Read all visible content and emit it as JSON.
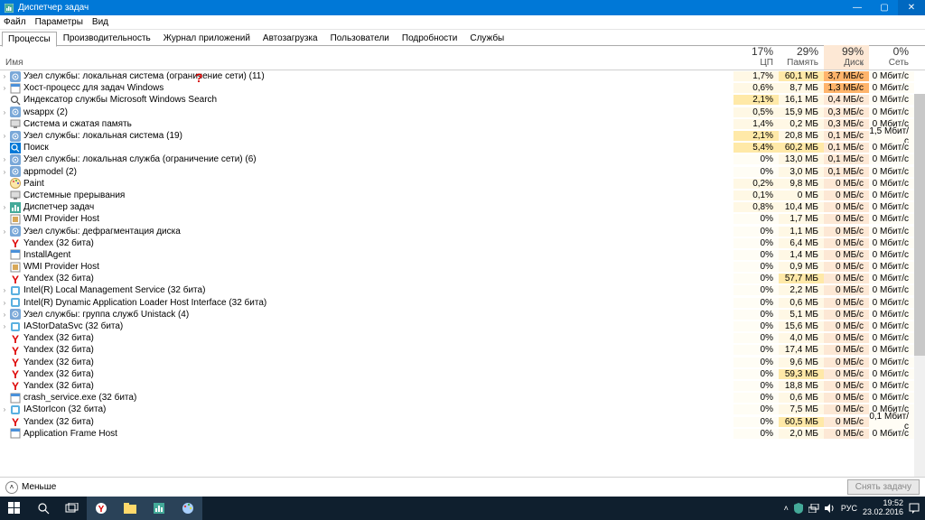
{
  "window": {
    "title": "Диспетчер задач",
    "controls": {
      "min": "—",
      "max": "▢",
      "close": "✕"
    }
  },
  "menu": [
    "Файл",
    "Параметры",
    "Вид"
  ],
  "tabs": [
    "Процессы",
    "Производительность",
    "Журнал приложений",
    "Автозагрузка",
    "Пользователи",
    "Подробности",
    "Службы"
  ],
  "columns": {
    "name": "Имя",
    "cpu": {
      "pct": "17%",
      "label": "ЦП"
    },
    "mem": {
      "pct": "29%",
      "label": "Память"
    },
    "disk": {
      "pct": "99%",
      "label": "Диск",
      "sorted": true,
      "arrow": "▾"
    },
    "net": {
      "pct": "0%",
      "label": "Сеть"
    }
  },
  "annotation": {
    "qmark": "?"
  },
  "processes": [
    {
      "exp": true,
      "icon": "svc",
      "name": "Узел службы: локальная система (ограничение сети) (11)",
      "cpu": "1,7%",
      "mem": "60,1 МБ",
      "disk": "3,7 МБ/с",
      "net": "0 Мбит/с",
      "underlined": true,
      "diskhot": true
    },
    {
      "exp": true,
      "icon": "exe",
      "name": "Хост-процесс для задач Windows",
      "cpu": "0,6%",
      "mem": "8,7 МБ",
      "disk": "1,3 МБ/с",
      "net": "0 Мбит/с",
      "underlined": true,
      "diskhot": true
    },
    {
      "exp": false,
      "icon": "search",
      "name": "Индексатор службы Microsoft Windows Search",
      "cpu": "2,1%",
      "mem": "16,1 МБ",
      "disk": "0,4 МБ/с",
      "net": "0 Мбит/с"
    },
    {
      "exp": true,
      "icon": "svc",
      "name": "wsappx (2)",
      "cpu": "0,5%",
      "mem": "15,9 МБ",
      "disk": "0,3 МБ/с",
      "net": "0 Мбит/с"
    },
    {
      "exp": false,
      "icon": "sys",
      "name": "Система и сжатая память",
      "cpu": "1,4%",
      "mem": "0,2 МБ",
      "disk": "0,3 МБ/с",
      "net": "0 Мбит/с"
    },
    {
      "exp": true,
      "icon": "svc",
      "name": "Узел службы: локальная система (19)",
      "cpu": "2,1%",
      "mem": "20,8 МБ",
      "disk": "0,1 МБ/с",
      "net": "1,5 Мбит/с"
    },
    {
      "exp": false,
      "icon": "searchblue",
      "name": "Поиск",
      "cpu": "5,4%",
      "mem": "60,2 МБ",
      "disk": "0,1 МБ/с",
      "net": "0 Мбит/с"
    },
    {
      "exp": true,
      "icon": "svc",
      "name": "Узел службы: локальная служба (ограничение сети) (6)",
      "cpu": "0%",
      "mem": "13,0 МБ",
      "disk": "0,1 МБ/с",
      "net": "0 Мбит/с"
    },
    {
      "exp": true,
      "icon": "svc",
      "name": "appmodel (2)",
      "cpu": "0%",
      "mem": "3,0 МБ",
      "disk": "0,1 МБ/с",
      "net": "0 Мбит/с"
    },
    {
      "exp": false,
      "icon": "paint",
      "name": "Paint",
      "cpu": "0,2%",
      "mem": "9,8 МБ",
      "disk": "0 МБ/с",
      "net": "0 Мбит/с"
    },
    {
      "exp": false,
      "icon": "sys",
      "name": "Системные прерывания",
      "cpu": "0,1%",
      "mem": "0 МБ",
      "disk": "0 МБ/с",
      "net": "0 Мбит/с"
    },
    {
      "exp": true,
      "icon": "taskmgr",
      "name": "Диспетчер задач",
      "cpu": "0,8%",
      "mem": "10,4 МБ",
      "disk": "0 МБ/с",
      "net": "0 Мбит/с"
    },
    {
      "exp": false,
      "icon": "wmi",
      "name": "WMI Provider Host",
      "cpu": "0%",
      "mem": "1,7 МБ",
      "disk": "0 МБ/с",
      "net": "0 Мбит/с"
    },
    {
      "exp": true,
      "icon": "svc",
      "name": "Узел службы: дефрагментация диска",
      "cpu": "0%",
      "mem": "1,1 МБ",
      "disk": "0 МБ/с",
      "net": "0 Мбит/с"
    },
    {
      "exp": false,
      "icon": "yandex",
      "name": "Yandex (32 бита)",
      "cpu": "0%",
      "mem": "6,4 МБ",
      "disk": "0 МБ/с",
      "net": "0 Мбит/с"
    },
    {
      "exp": false,
      "icon": "exe",
      "name": "InstallAgent",
      "cpu": "0%",
      "mem": "1,4 МБ",
      "disk": "0 МБ/с",
      "net": "0 Мбит/с"
    },
    {
      "exp": false,
      "icon": "wmi",
      "name": "WMI Provider Host",
      "cpu": "0%",
      "mem": "0,9 МБ",
      "disk": "0 МБ/с",
      "net": "0 Мбит/с"
    },
    {
      "exp": false,
      "icon": "yandex",
      "name": "Yandex (32 бита)",
      "cpu": "0%",
      "mem": "57,7 МБ",
      "disk": "0 МБ/с",
      "net": "0 Мбит/с"
    },
    {
      "exp": true,
      "icon": "intel",
      "name": "Intel(R) Local Management Service (32 бита)",
      "cpu": "0%",
      "mem": "2,2 МБ",
      "disk": "0 МБ/с",
      "net": "0 Мбит/с"
    },
    {
      "exp": true,
      "icon": "intel",
      "name": "Intel(R) Dynamic Application Loader Host Interface (32 бита)",
      "cpu": "0%",
      "mem": "0,6 МБ",
      "disk": "0 МБ/с",
      "net": "0 Мбит/с"
    },
    {
      "exp": true,
      "icon": "svc",
      "name": "Узел службы: группа служб Unistack (4)",
      "cpu": "0%",
      "mem": "5,1 МБ",
      "disk": "0 МБ/с",
      "net": "0 Мбит/с"
    },
    {
      "exp": true,
      "icon": "intel",
      "name": "IAStorDataSvc (32 бита)",
      "cpu": "0%",
      "mem": "15,6 МБ",
      "disk": "0 МБ/с",
      "net": "0 Мбит/с"
    },
    {
      "exp": false,
      "icon": "yandex",
      "name": "Yandex (32 бита)",
      "cpu": "0%",
      "mem": "4,0 МБ",
      "disk": "0 МБ/с",
      "net": "0 Мбит/с"
    },
    {
      "exp": false,
      "icon": "yandex",
      "name": "Yandex (32 бита)",
      "cpu": "0%",
      "mem": "17,4 МБ",
      "disk": "0 МБ/с",
      "net": "0 Мбит/с"
    },
    {
      "exp": false,
      "icon": "yandex",
      "name": "Yandex (32 бита)",
      "cpu": "0%",
      "mem": "9,6 МБ",
      "disk": "0 МБ/с",
      "net": "0 Мбит/с"
    },
    {
      "exp": false,
      "icon": "yandex",
      "name": "Yandex (32 бита)",
      "cpu": "0%",
      "mem": "59,3 МБ",
      "disk": "0 МБ/с",
      "net": "0 Мбит/с"
    },
    {
      "exp": false,
      "icon": "yandex",
      "name": "Yandex (32 бита)",
      "cpu": "0%",
      "mem": "18,8 МБ",
      "disk": "0 МБ/с",
      "net": "0 Мбит/с"
    },
    {
      "exp": false,
      "icon": "exe",
      "name": "crash_service.exe (32 бита)",
      "cpu": "0%",
      "mem": "0,6 МБ",
      "disk": "0 МБ/с",
      "net": "0 Мбит/с"
    },
    {
      "exp": true,
      "icon": "intel",
      "name": "IAStorIcon (32 бита)",
      "cpu": "0%",
      "mem": "7,5 МБ",
      "disk": "0 МБ/с",
      "net": "0 Мбит/с"
    },
    {
      "exp": false,
      "icon": "yandex",
      "name": "Yandex (32 бита)",
      "cpu": "0%",
      "mem": "60,5 МБ",
      "disk": "0 МБ/с",
      "net": "0,1 Мбит/с"
    },
    {
      "exp": false,
      "icon": "exe",
      "name": "Application Frame Host",
      "cpu": "0%",
      "mem": "2,0 МБ",
      "disk": "0 МБ/с",
      "net": "0 Мбит/с"
    }
  ],
  "footer": {
    "fewer": "Меньше",
    "endtask": "Снять задачу"
  },
  "taskbar": {
    "tray": {
      "lang": "РУС",
      "time": "19:52",
      "date": "23.02.2016",
      "up": "˄"
    }
  }
}
